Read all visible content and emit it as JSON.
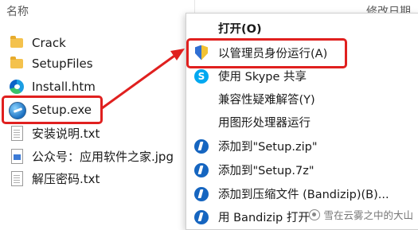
{
  "explorer": {
    "column_name": "名称",
    "column_modified": "修改日期",
    "files": [
      {
        "name": "Crack",
        "icon": "folder-icon"
      },
      {
        "name": "SetupFiles",
        "icon": "folder-icon"
      },
      {
        "name": "Install.htm",
        "icon": "edge-icon"
      },
      {
        "name": "Setup.exe",
        "icon": "installer-icon"
      },
      {
        "name": "安装说明.txt",
        "icon": "text-file-icon"
      },
      {
        "name": "公众号：应用软件之家.jpg",
        "icon": "image-file-icon"
      },
      {
        "name": "解压密码.txt",
        "icon": "text-file-icon"
      }
    ]
  },
  "context_menu": {
    "items": [
      {
        "label": "打开(O)",
        "icon": ""
      },
      {
        "label": "以管理员身份运行(A)",
        "icon": "uac-shield-icon"
      },
      {
        "label": "使用 Skype 共享",
        "icon": "skype-icon"
      },
      {
        "label": "兼容性疑难解答(Y)",
        "icon": ""
      },
      {
        "label": "用图形处理器运行",
        "icon": ""
      },
      {
        "label": "添加到\"Setup.zip\"",
        "icon": "bandizip-icon"
      },
      {
        "label": "添加到\"Setup.7z\"",
        "icon": "bandizip-icon"
      },
      {
        "label": "添加到压缩文件 (Bandizip)(B)...",
        "icon": "bandizip-icon"
      },
      {
        "label": "用 Bandizip 打开",
        "icon": "bandizip-icon"
      }
    ]
  },
  "watermark": {
    "text": "雪在云雾之中的大山"
  },
  "colors": {
    "highlight_red": "#e0201f",
    "folder_yellow": "#f4c24d"
  }
}
